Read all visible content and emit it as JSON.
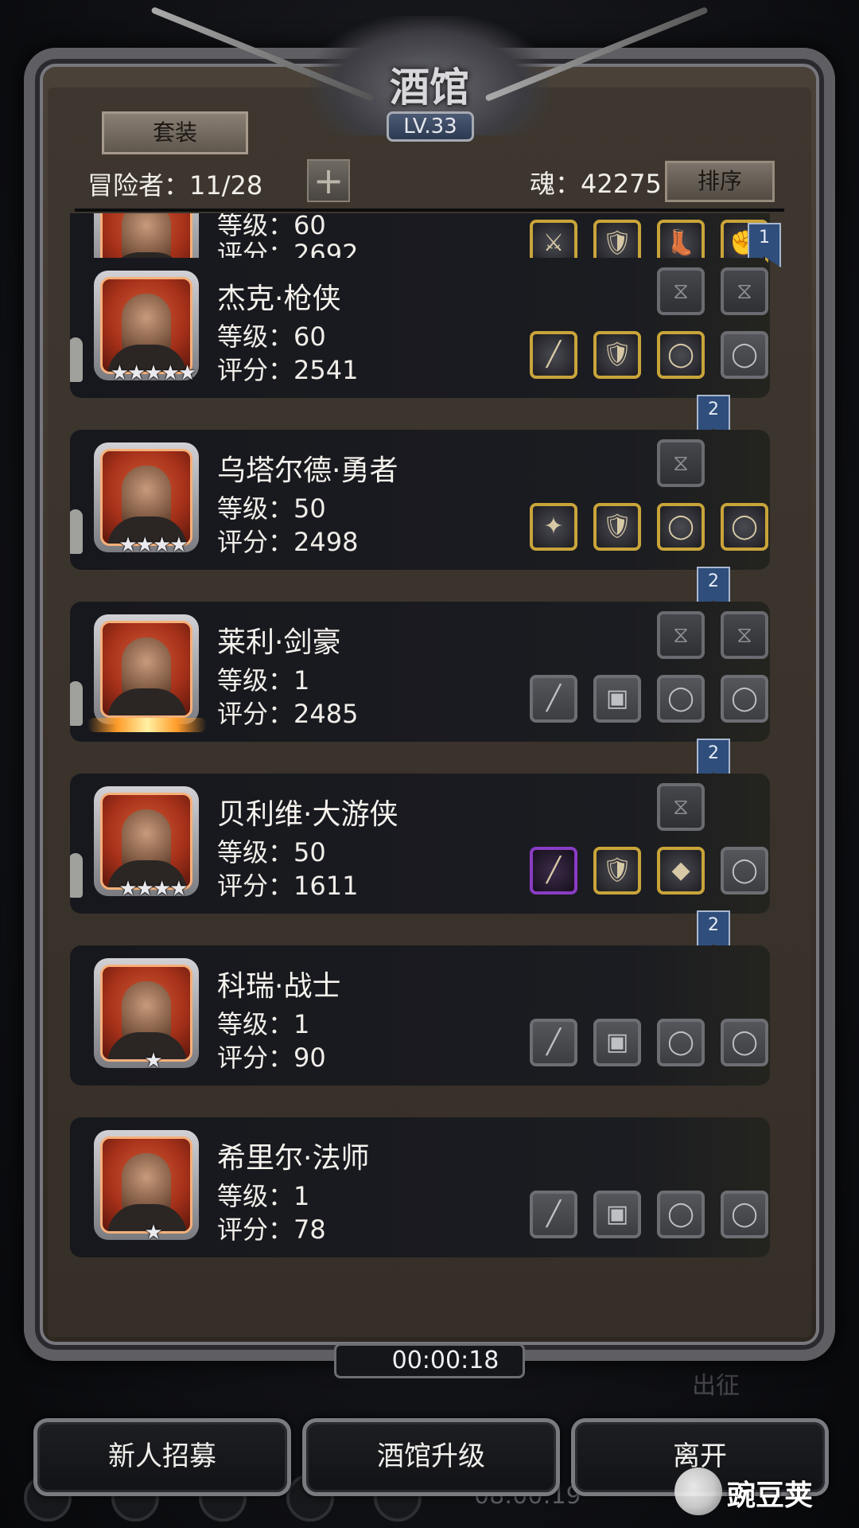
{
  "header": {
    "title": "酒馆",
    "level": "LV.33",
    "suit_button": "套装",
    "adventurers": "冒险者：11/28",
    "plus_button": "+",
    "soul": "魂：42275",
    "sort_button": "排序"
  },
  "heroes": [
    {
      "name": "",
      "level": "等级：60",
      "score": "评分：2692",
      "stars": "★★★★★",
      "skills": [],
      "equipment": [
        {
          "type": "filled",
          "icon": "blade-icon",
          "glyph": "⚔"
        },
        {
          "type": "filled",
          "icon": "armor-icon",
          "glyph": "🛡"
        },
        {
          "type": "filled",
          "icon": "boots-icon",
          "glyph": "👢"
        },
        {
          "type": "filled",
          "icon": "gauntlet-icon",
          "glyph": "✊"
        }
      ],
      "bookmark": "1"
    },
    {
      "name": "杰克·枪侠",
      "level": "等级：60",
      "score": "评分：2541",
      "stars": "★★★★★",
      "skills": [
        "hourglass-icon",
        "hourglass-icon"
      ],
      "equipment": [
        {
          "type": "filled",
          "icon": "rifle-icon",
          "glyph": "╱"
        },
        {
          "type": "filled",
          "icon": "armor-icon",
          "glyph": "🛡"
        },
        {
          "type": "filled",
          "icon": "ring-icon",
          "glyph": "◯"
        },
        {
          "type": "empty",
          "icon": "ring-slot-icon",
          "glyph": "◯"
        }
      ],
      "bookmark": "2"
    },
    {
      "name": "乌塔尔德·勇者",
      "level": "等级：50",
      "score": "评分：2498",
      "stars": "★★★★",
      "skills": [
        "hourglass-icon"
      ],
      "equipment": [
        {
          "type": "filled",
          "icon": "mace-icon",
          "glyph": "✦"
        },
        {
          "type": "filled",
          "icon": "armor-icon",
          "glyph": "🛡"
        },
        {
          "type": "filled",
          "icon": "ring-icon",
          "glyph": "◯"
        },
        {
          "type": "filled",
          "icon": "ring-icon",
          "glyph": "◯"
        }
      ],
      "bookmark": "2"
    },
    {
      "name": "莱利·剑豪",
      "level": "等级：1",
      "score": "评分：2485",
      "stars": "",
      "skills": [
        "hourglass-icon",
        "hourglass-icon"
      ],
      "equipment": [
        {
          "type": "empty",
          "icon": "sword-slot-icon",
          "glyph": "╱"
        },
        {
          "type": "empty",
          "icon": "armor-slot-icon",
          "glyph": "▣"
        },
        {
          "type": "empty",
          "icon": "ring-slot-icon",
          "glyph": "◯"
        },
        {
          "type": "empty",
          "icon": "ring-slot-icon",
          "glyph": "◯"
        }
      ],
      "bookmark": "2"
    },
    {
      "name": "贝利维·大游侠",
      "level": "等级：50",
      "score": "评分：1611",
      "stars": "★★★★",
      "skills": [
        "hourglass-icon"
      ],
      "equipment": [
        {
          "type": "epic",
          "icon": "crossbow-icon",
          "glyph": "╱"
        },
        {
          "type": "filled",
          "icon": "armor-icon",
          "glyph": "🛡"
        },
        {
          "type": "filled",
          "icon": "amulet-icon",
          "glyph": "◆"
        },
        {
          "type": "empty",
          "icon": "ring-slot-icon",
          "glyph": "◯"
        }
      ],
      "bookmark": "2"
    },
    {
      "name": "科瑞·战士",
      "level": "等级：1",
      "score": "评分：90",
      "stars": "★",
      "skills": [],
      "equipment": [
        {
          "type": "empty",
          "icon": "sword-slot-icon",
          "glyph": "╱"
        },
        {
          "type": "empty",
          "icon": "armor-slot-icon",
          "glyph": "▣"
        },
        {
          "type": "empty",
          "icon": "ring-slot-icon",
          "glyph": "◯"
        },
        {
          "type": "empty",
          "icon": "ring-slot-icon",
          "glyph": "◯"
        }
      ],
      "bookmark": ""
    },
    {
      "name": "希里尔·法师",
      "level": "等级：1",
      "score": "评分：78",
      "stars": "★",
      "skills": [],
      "equipment": [
        {
          "type": "empty",
          "icon": "staff-slot-icon",
          "glyph": "╱"
        },
        {
          "type": "empty",
          "icon": "armor-slot-icon",
          "glyph": "▣"
        },
        {
          "type": "empty",
          "icon": "ring-slot-icon",
          "glyph": "◯"
        },
        {
          "type": "empty",
          "icon": "ring-slot-icon",
          "glyph": "◯"
        }
      ],
      "bookmark": ""
    }
  ],
  "timer": "00:00:18",
  "background": {
    "expedition": "出征",
    "clock": "08:00:19"
  },
  "buttons": {
    "recruit": "新人招募",
    "upgrade": "酒馆升级",
    "leave": "离开"
  },
  "watermark": "豌豆荚",
  "colors": {
    "gold_border": "#c9a43a",
    "epic_border": "#8a3cc4",
    "bookmark": "#2f4e7c",
    "portrait_bg": "#a6311a"
  }
}
